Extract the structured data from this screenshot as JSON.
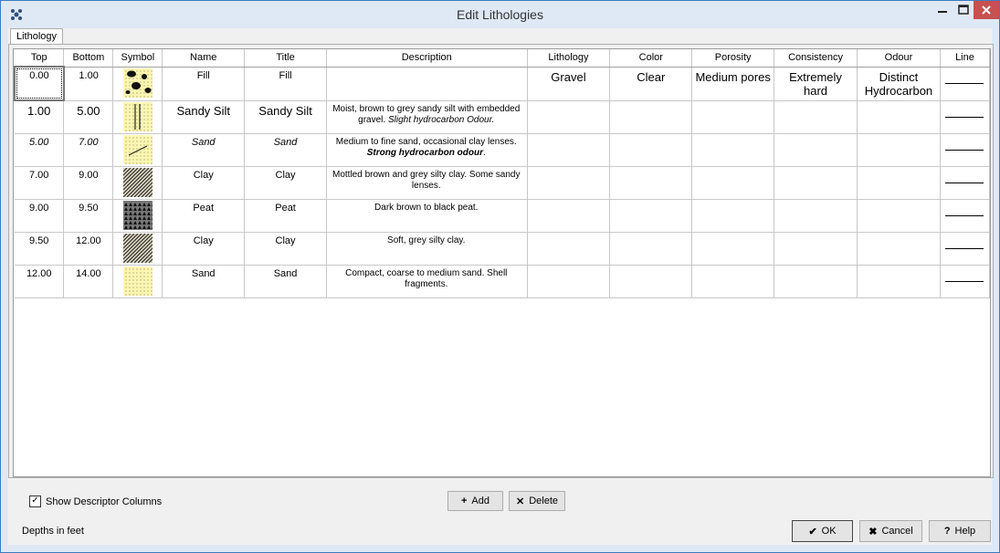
{
  "window": {
    "title": "Edit Lithologies"
  },
  "tabs": [
    {
      "label": "Lithology"
    }
  ],
  "grid": {
    "columns": [
      "Top",
      "Bottom",
      "Symbol",
      "Name",
      "Title",
      "Description",
      "Lithology",
      "Color",
      "Porosity",
      "Consistency",
      "Odour",
      "Line"
    ],
    "rows": [
      {
        "top": "0.00",
        "bottom": "1.00",
        "symbol": "gravel-pattern",
        "name": "Fill",
        "title": "Fill",
        "desc": "",
        "desc_em": "",
        "lithology": "Gravel",
        "color": "Clear",
        "porosity": "Medium pores",
        "consistency": "Extremely hard",
        "odour": "Distinct Hydrocarbon"
      },
      {
        "top": "1.00",
        "bottom": "5.00",
        "symbol": "sandy-silt-pattern",
        "name": "Sandy Silt",
        "title": "Sandy Silt",
        "desc": "Moist, brown to grey sandy silt with embedded gravel. ",
        "desc_em": "Slight hydrocarbon Odour.",
        "lithology": "",
        "color": "",
        "porosity": "",
        "consistency": "",
        "odour": ""
      },
      {
        "top": "5.00",
        "bottom": "7.00",
        "symbol": "sand-lines-pattern",
        "name": "Sand",
        "title": "Sand",
        "desc": "Medium to fine sand, occasional clay lenses. ",
        "desc_em": "Strong hydrocarbon odour",
        "desc_tail": ".",
        "lithology": "",
        "color": "",
        "porosity": "",
        "consistency": "",
        "odour": ""
      },
      {
        "top": "7.00",
        "bottom": "9.00",
        "symbol": "clay-hatch-pattern",
        "name": "Clay",
        "title": "Clay",
        "desc": "Mottled brown and grey silty clay. Some sandy lenses.",
        "desc_em": "",
        "lithology": "",
        "color": "",
        "porosity": "",
        "consistency": "",
        "odour": ""
      },
      {
        "top": "9.00",
        "bottom": "9.50",
        "symbol": "peat-pattern",
        "name": "Peat",
        "title": "Peat",
        "desc": "Dark brown to black peat.",
        "desc_em": "",
        "lithology": "",
        "color": "",
        "porosity": "",
        "consistency": "",
        "odour": ""
      },
      {
        "top": "9.50",
        "bottom": "12.00",
        "symbol": "clay-hatch-pattern",
        "name": "Clay",
        "title": "Clay",
        "desc": "Soft, grey silty clay.",
        "desc_em": "",
        "lithology": "",
        "color": "",
        "porosity": "",
        "consistency": "",
        "odour": ""
      },
      {
        "top": "12.00",
        "bottom": "14.00",
        "symbol": "sand-dots-pattern",
        "name": "Sand",
        "title": "Sand",
        "desc": "Compact, coarse to medium sand. Shell fragments.",
        "desc_em": "",
        "lithology": "",
        "color": "",
        "porosity": "",
        "consistency": "",
        "odour": ""
      }
    ]
  },
  "footer": {
    "show_descriptor_label": "Show Descriptor Columns",
    "show_descriptor_checked": true,
    "add_label": "Add",
    "delete_label": "Delete",
    "status": "Depths in feet",
    "ok_label": "OK",
    "cancel_label": "Cancel",
    "help_label": "Help"
  },
  "colors": {
    "symbol_fill": "#fdf6b0",
    "close_button": "#c75050",
    "frame": "#dfe9f5"
  }
}
